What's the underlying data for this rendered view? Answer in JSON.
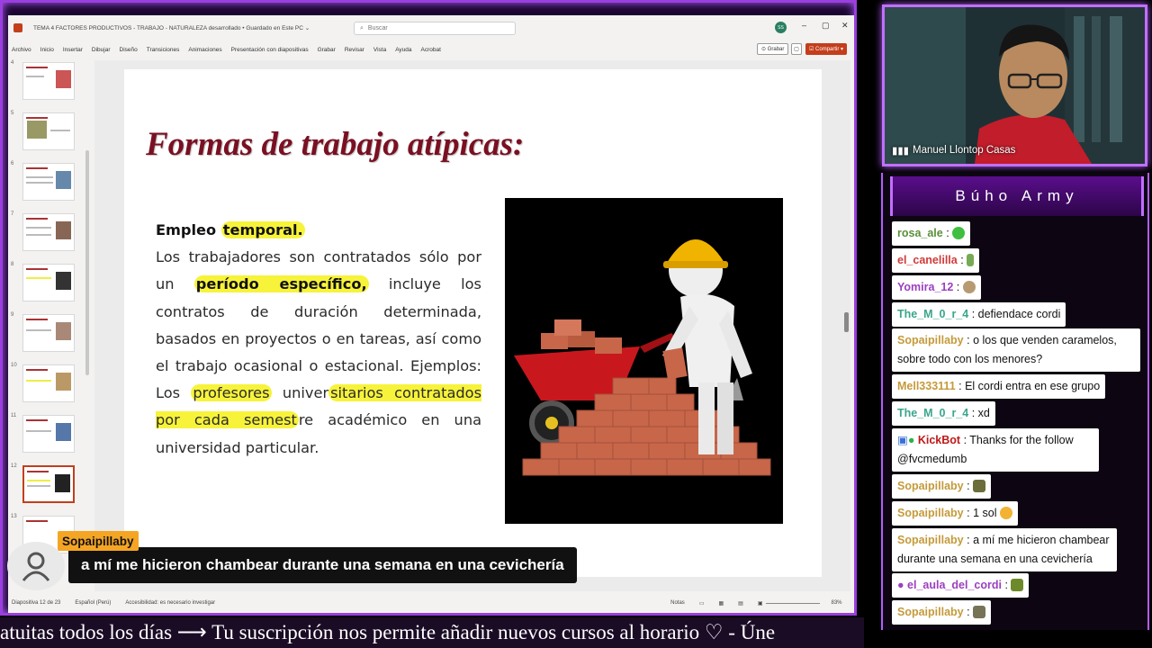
{
  "ppt": {
    "doc_title": "TEMA 4 FACTORES PRODUCTIVOS - TRABAJO - NATURALEZA desarrollado • Guardado en Este PC ⌄",
    "search_placeholder": "Buscar",
    "user_initials": "SS",
    "window_buttons": [
      "–",
      "▢",
      "✕"
    ],
    "menu": [
      "Archivo",
      "Inicio",
      "Insertar",
      "Dibujar",
      "Diseño",
      "Transiciones",
      "Animaciones",
      "Presentación con diapositivas",
      "Grabar",
      "Revisar",
      "Vista",
      "Ayuda",
      "Acrobat"
    ],
    "record_label": "⊙ Grabar",
    "comment_label": "▢",
    "share_label": "☑ Compartir ▾",
    "thumb_numbers": [
      "4",
      "5",
      "6",
      "7",
      "8",
      "9",
      "10",
      "11",
      "12",
      "13"
    ],
    "slide": {
      "title": "Formas de trabajo atípicas:",
      "heading_plain": "Empleo ",
      "heading_hl": "temporal.",
      "p_line1": "Los trabajadores son contratados sólo por un",
      "p_bold": "período específico,",
      "p_after_bold": " incluye los contratos de duración determinada, basados en proyectos o en tareas, así como el trabajo ocasional o estacional. Ejemplos: Los ",
      "p_hl1": "profesores",
      "p_pre_hl2": " univer",
      "p_hl2": "sitarios contratados por cada semest",
      "p_after_hl2": "re académico en una universidad particular."
    },
    "status": {
      "slide_counter": "Diapositiva 12 de 23",
      "language": "Español (Perú)",
      "accessibility": "Accesibilidad: es necesario investigar",
      "notes": "Notas",
      "zoom": "83%"
    }
  },
  "cam": {
    "name": "Manuel Llontop Casas"
  },
  "chat": {
    "title": "Búho Army",
    "messages": [
      {
        "user": "rosa_ale",
        "text": " ",
        "emote": "green-blob"
      },
      {
        "user": "el_canelilla",
        "text": " ",
        "emote": "fork-plant"
      },
      {
        "user": "Yomira_12",
        "text": " ",
        "emote": "hedgehog"
      },
      {
        "user": "The_M_0_r_4",
        "text": "defiendace cordi"
      },
      {
        "user": "Sopaipillaby",
        "text": "o los que venden caramelos, sobre todo con los menores?"
      },
      {
        "user": "Mell333111",
        "text": "El cordi entra en ese grupo"
      },
      {
        "user": "The_M_0_r_4",
        "text": "xd"
      },
      {
        "user": "KickBot",
        "text": "Thanks for the follow @fvcmedumb"
      },
      {
        "user": "Sopaipillaby",
        "text": " ",
        "emote": "cat-meme"
      },
      {
        "user": "Sopaipillaby",
        "text": "1 sol",
        "emote": "sad-face"
      },
      {
        "user": "Sopaipillaby",
        "text": "a mí me hicieron chambear durante una semana en una cevichería"
      },
      {
        "user": "el_aula_del_cordi",
        "text": " ",
        "emote": "snail"
      },
      {
        "user": "Sopaipillaby",
        "text": " ",
        "emote": "cat-meme"
      }
    ]
  },
  "subtitle": {
    "user": "Sopaipillaby",
    "text": "a mí me hicieron chambear durante una semana en una cevichería"
  },
  "ticker": {
    "text": "atuitas todos los días  ⟶  Tu suscripción nos permite añadir nuevos cursos al horario  ♡   -  Úne"
  },
  "colors": {
    "frame_purple": "#9b3fe0",
    "slide_title": "#7a1022",
    "highlight": "#f7f33a",
    "subtitle_name_bg": "#f5a524",
    "share_button": "#c43e1c"
  }
}
